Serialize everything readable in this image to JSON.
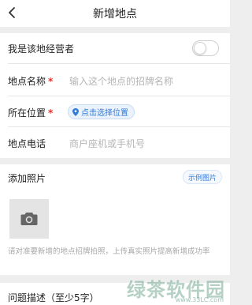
{
  "header": {
    "title": "新增地点"
  },
  "owner": {
    "label": "我是该地经营者"
  },
  "name": {
    "label": "地点名称",
    "required_mark": "*",
    "placeholder": "输入这个地点的招牌名称"
  },
  "location": {
    "label": "所在位置",
    "required_mark": "*",
    "button_label": "点击选择位置"
  },
  "phone": {
    "label": "地点电话",
    "placeholder": "商户座机或手机号"
  },
  "photos": {
    "title": "添加照片",
    "example_label": "示例图片",
    "hint": "请对准要新增的地点招牌拍照，上传真实照片提高新增成功率"
  },
  "description": {
    "label": "问题描述（至少5字）"
  },
  "watermark": {
    "text": "绿茶软件园",
    "sub": "www.33LC.com"
  },
  "colors": {
    "accent": "#2f7bd8",
    "required": "#e0312f",
    "placeholder": "#b5b5b5",
    "background": "#eeeeee"
  }
}
